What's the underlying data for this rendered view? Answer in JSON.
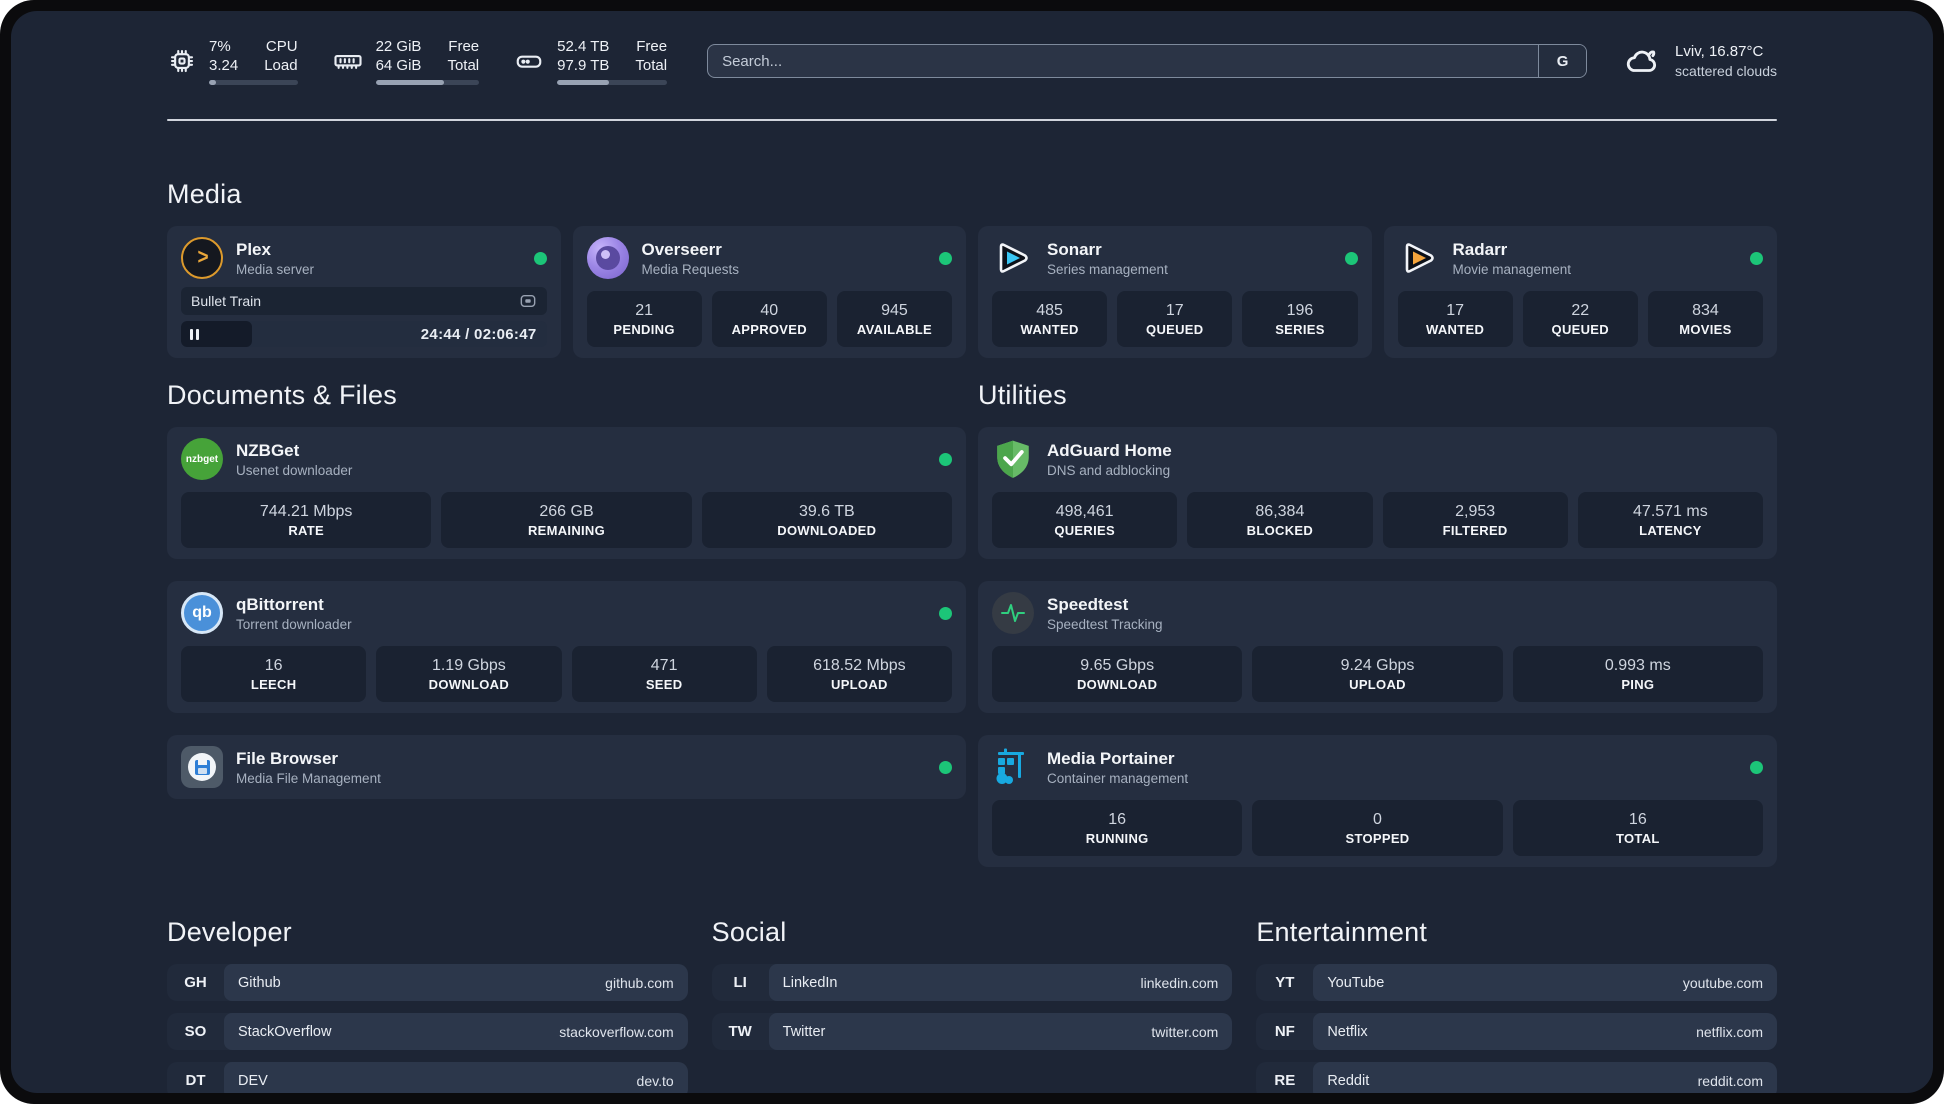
{
  "header": {
    "system_stats": [
      {
        "icon": "cpu-icon",
        "value_top": "7%",
        "value_bottom": "3.24",
        "label_top": "CPU",
        "label_bottom": "Load",
        "progress_pct": 8
      },
      {
        "icon": "ram-icon",
        "value_top": "22 GiB",
        "value_bottom": "64 GiB",
        "label_top": "Free",
        "label_bottom": "Total",
        "progress_pct": 66
      },
      {
        "icon": "disk-icon",
        "value_top": "52.4 TB",
        "value_bottom": "97.9 TB",
        "label_top": "Free",
        "label_bottom": "Total",
        "progress_pct": 47
      }
    ],
    "search": {
      "placeholder": "Search...",
      "engine_label": "G"
    },
    "weather": {
      "location_temp": "Lviv, 16.87°C",
      "condition": "scattered clouds"
    }
  },
  "sections": {
    "media": {
      "title": "Media",
      "plex": {
        "title": "Plex",
        "subtitle": "Media server",
        "now_playing": "Bullet Train",
        "time": "24:44 / 02:06:47",
        "progress_pct": 19.5
      },
      "overseerr": {
        "title": "Overseerr",
        "subtitle": "Media Requests",
        "stats": [
          {
            "value": "21",
            "label": "PENDING"
          },
          {
            "value": "40",
            "label": "APPROVED"
          },
          {
            "value": "945",
            "label": "AVAILABLE"
          }
        ]
      },
      "sonarr": {
        "title": "Sonarr",
        "subtitle": "Series management",
        "stats": [
          {
            "value": "485",
            "label": "WANTED"
          },
          {
            "value": "17",
            "label": "QUEUED"
          },
          {
            "value": "196",
            "label": "SERIES"
          }
        ]
      },
      "radarr": {
        "title": "Radarr",
        "subtitle": "Movie management",
        "stats": [
          {
            "value": "17",
            "label": "WANTED"
          },
          {
            "value": "22",
            "label": "QUEUED"
          },
          {
            "value": "834",
            "label": "MOVIES"
          }
        ]
      }
    },
    "documents": {
      "title": "Documents & Files",
      "nzbget": {
        "title": "NZBGet",
        "subtitle": "Usenet downloader",
        "icon_text": "nzbget",
        "stats": [
          {
            "value": "744.21 Mbps",
            "label": "RATE"
          },
          {
            "value": "266 GB",
            "label": "REMAINING"
          },
          {
            "value": "39.6 TB",
            "label": "DOWNLOADED"
          }
        ]
      },
      "qbittorrent": {
        "title": "qBittorrent",
        "subtitle": "Torrent downloader",
        "icon_text": "qb",
        "stats": [
          {
            "value": "16",
            "label": "LEECH"
          },
          {
            "value": "1.19 Gbps",
            "label": "DOWNLOAD"
          },
          {
            "value": "471",
            "label": "SEED"
          },
          {
            "value": "618.52 Mbps",
            "label": "UPLOAD"
          }
        ]
      },
      "filebrowser": {
        "title": "File Browser",
        "subtitle": "Media File Management"
      }
    },
    "utilities": {
      "title": "Utilities",
      "adguard": {
        "title": "AdGuard Home",
        "subtitle": "DNS and adblocking",
        "stats": [
          {
            "value": "498,461",
            "label": "QUERIES"
          },
          {
            "value": "86,384",
            "label": "BLOCKED"
          },
          {
            "value": "2,953",
            "label": "FILTERED"
          },
          {
            "value": "47.571 ms",
            "label": "LATENCY"
          }
        ]
      },
      "speedtest": {
        "title": "Speedtest",
        "subtitle": "Speedtest Tracking",
        "stats": [
          {
            "value": "9.65 Gbps",
            "label": "DOWNLOAD"
          },
          {
            "value": "9.24 Gbps",
            "label": "UPLOAD"
          },
          {
            "value": "0.993 ms",
            "label": "PING"
          }
        ]
      },
      "portainer": {
        "title": "Media Portainer",
        "subtitle": "Container management",
        "stats": [
          {
            "value": "16",
            "label": "RUNNING"
          },
          {
            "value": "0",
            "label": "STOPPED"
          },
          {
            "value": "16",
            "label": "TOTAL"
          }
        ]
      }
    },
    "bookmarks": {
      "developer": {
        "title": "Developer",
        "items": [
          {
            "abbr": "GH",
            "name": "Github",
            "url": "github.com"
          },
          {
            "abbr": "SO",
            "name": "StackOverflow",
            "url": "stackoverflow.com"
          },
          {
            "abbr": "DT",
            "name": "DEV",
            "url": "dev.to"
          }
        ]
      },
      "social": {
        "title": "Social",
        "items": [
          {
            "abbr": "LI",
            "name": "LinkedIn",
            "url": "linkedin.com"
          },
          {
            "abbr": "TW",
            "name": "Twitter",
            "url": "twitter.com"
          }
        ]
      },
      "entertainment": {
        "title": "Entertainment",
        "items": [
          {
            "abbr": "YT",
            "name": "YouTube",
            "url": "youtube.com"
          },
          {
            "abbr": "NF",
            "name": "Netflix",
            "url": "netflix.com"
          },
          {
            "abbr": "RE",
            "name": "Reddit",
            "url": "reddit.com"
          }
        ]
      }
    }
  },
  "colors": {
    "status_online": "#1cc578",
    "accent_plex": "#e9a63a",
    "accent_sonarr": "#39c6f4",
    "accent_radarr": "#f5a53c"
  }
}
